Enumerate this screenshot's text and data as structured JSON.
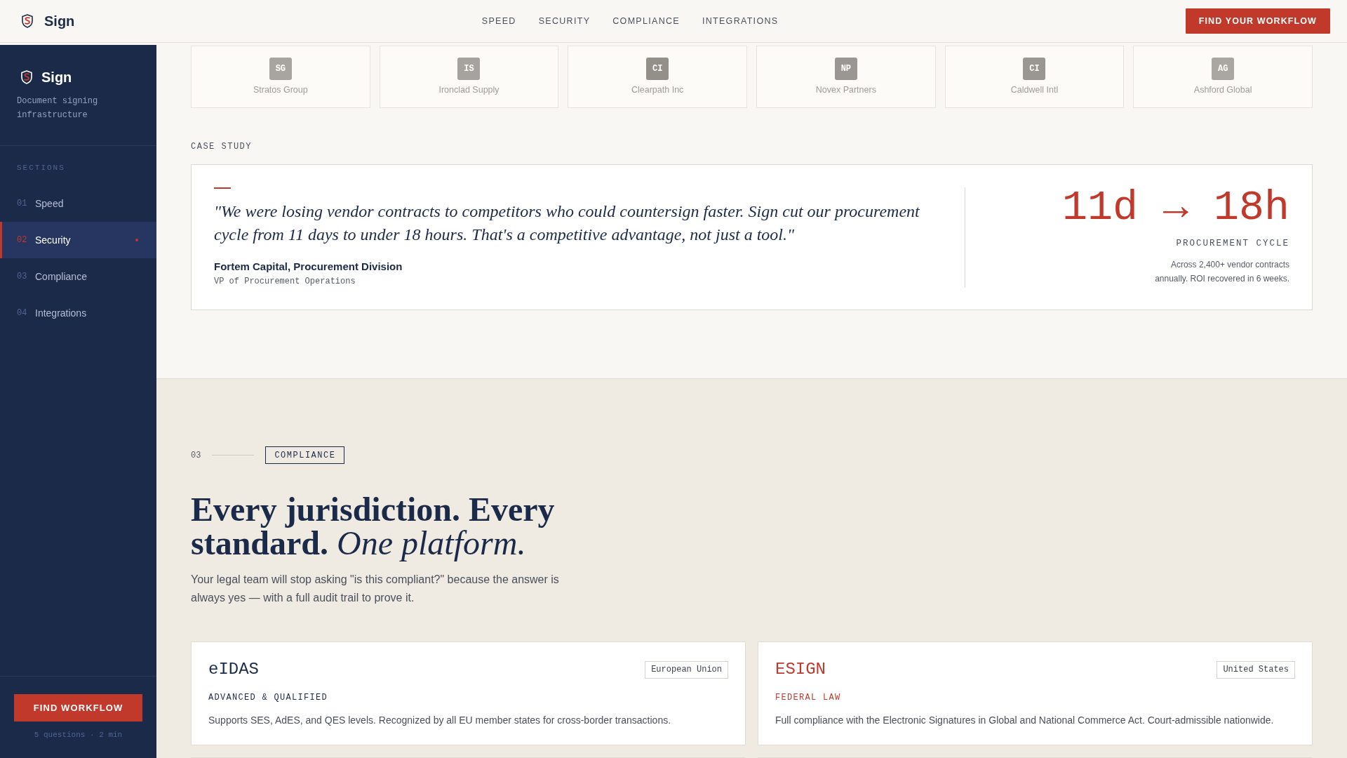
{
  "nav": {
    "brand": "Sign",
    "links": [
      {
        "label": "SPEED"
      },
      {
        "label": "SECURITY"
      },
      {
        "label": "COMPLIANCE"
      },
      {
        "label": "INTEGRATIONS"
      }
    ],
    "cta": "FIND YOUR WORKFLOW"
  },
  "sidebar": {
    "brand": "Sign",
    "tagline": "Document signing infrastructure",
    "heading": "SECTIONS",
    "items": [
      {
        "number": "01",
        "label": "Speed",
        "selected": false
      },
      {
        "number": "02",
        "label": "Security",
        "selected": true
      },
      {
        "number": "03",
        "label": "Compliance",
        "selected": false
      },
      {
        "number": "04",
        "label": "Integrations",
        "selected": false
      }
    ],
    "cta": "FIND WORKFLOW",
    "note": "5 questions · 2 min"
  },
  "logos": [
    {
      "initials": "SG",
      "name": "Stratos Group",
      "color": "#a8a5a0"
    },
    {
      "initials": "IS",
      "name": "Ironclad Supply",
      "color": "#a6a39e"
    },
    {
      "initials": "CI",
      "name": "Clearpath Inc",
      "color": "#93908a"
    },
    {
      "initials": "NP",
      "name": "Novex Partners",
      "color": "#9a9792"
    },
    {
      "initials": "CI",
      "name": "Caldwell Intl",
      "color": "#9a9792"
    },
    {
      "initials": "AG",
      "name": "Ashford Global",
      "color": "#aaa7a2"
    }
  ],
  "case_study": {
    "label": "CASE STUDY",
    "quote": "\"We were losing vendor contracts to competitors who could countersign faster. Sign cut our procurement cycle from 11 days to under 18 hours. That's a competitive advantage, not just a tool.\"",
    "author": "Fortem Capital, Procurement Division",
    "role": "VP of Procurement Operations",
    "metric": "11d → 18h",
    "metric_label": "PROCUREMENT CYCLE",
    "metric_note": "Across 2,400+ vendor contracts annually. ROI recovered in 6 weeks."
  },
  "compliance": {
    "number": "03",
    "tag": "COMPLIANCE",
    "headline": "Every jurisdiction. Every standard. *One platform.*",
    "intro": "Your legal team will stop asking \"is this compliant?\" because the answer is always yes — with a full audit trail to prove it.",
    "cards": [
      {
        "title": "eIDAS",
        "region": "European Union",
        "subtitle": "ADVANCED & QUALIFIED",
        "text": "Supports SES, AdES, and QES levels. Recognized by all EU member states for cross-border transactions.",
        "color": "#1c2a4a"
      },
      {
        "title": "ESIGN",
        "region": "United States",
        "subtitle": "FEDERAL LAW",
        "text": "Full compliance with the Electronic Signatures in Global and National Commerce Act. Court-admissible nationwide.",
        "color": "#c0392b"
      }
    ]
  }
}
